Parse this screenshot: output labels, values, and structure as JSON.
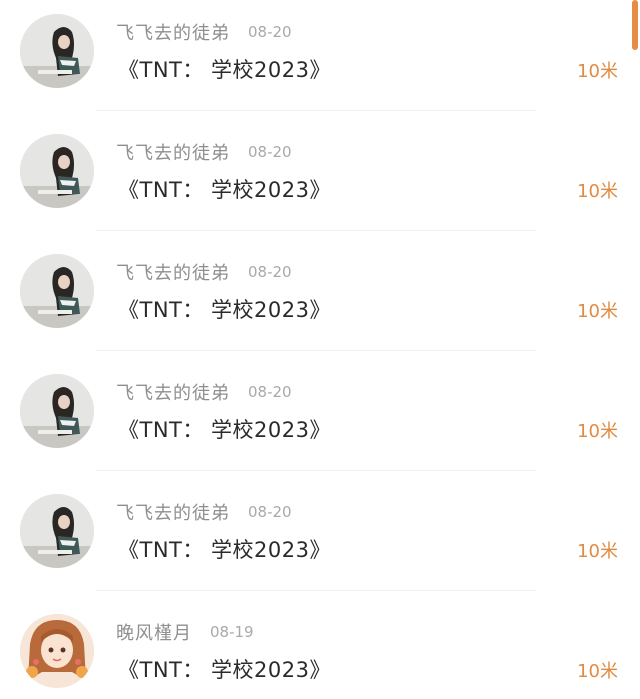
{
  "comments": [
    {
      "user": "飞飞去的徒弟",
      "date": "08-20",
      "message": "《TNT： 学校2023》",
      "amount": "10米",
      "avatar": "girl-writing-avatar-icon"
    },
    {
      "user": "飞飞去的徒弟",
      "date": "08-20",
      "message": "《TNT： 学校2023》",
      "amount": "10米",
      "avatar": "girl-writing-avatar-icon"
    },
    {
      "user": "飞飞去的徒弟",
      "date": "08-20",
      "message": "《TNT： 学校2023》",
      "amount": "10米",
      "avatar": "girl-writing-avatar-icon"
    },
    {
      "user": "飞飞去的徒弟",
      "date": "08-20",
      "message": "《TNT： 学校2023》",
      "amount": "10米",
      "avatar": "girl-writing-avatar-icon"
    },
    {
      "user": "飞飞去的徒弟",
      "date": "08-20",
      "message": "《TNT： 学校2023》",
      "amount": "10米",
      "avatar": "girl-writing-avatar-icon"
    },
    {
      "user": "晚风槿月",
      "date": "08-19",
      "message": "《TNT： 学校2023》",
      "amount": "10米",
      "avatar": "cartoon-girl-avatar-icon"
    }
  ],
  "colors": {
    "amount": "#e38a42",
    "username": "#8f8f8f",
    "scrollbar": "#e58c45"
  }
}
